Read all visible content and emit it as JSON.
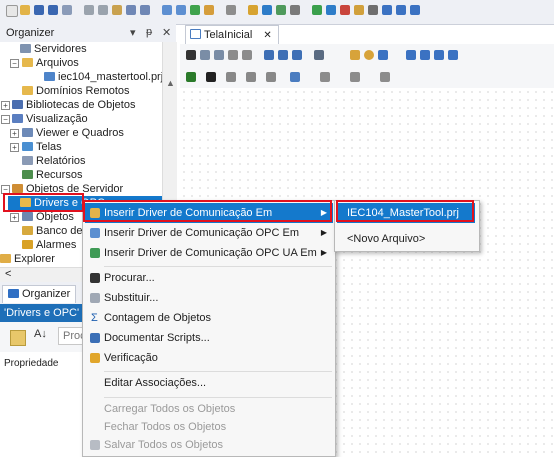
{
  "colors": {
    "accent_blue": "#1479cc",
    "highlight_red": "#e1111e",
    "panel_bg": "#eef0f5",
    "menu_bg": "#f7f7f7"
  },
  "organizer": {
    "title": "Organizer",
    "pin_glyph": "▾",
    "pin2_glyph": "ᵽ",
    "close_glyph": "✕",
    "tree": [
      {
        "label": "Servidores",
        "icon": "server-icon"
      },
      {
        "label": "Arquivos",
        "icon": "folder-icon"
      },
      {
        "label": "iec104_mastertool.prj",
        "icon": "project-file-icon"
      },
      {
        "label": "Domínios Remotos",
        "icon": "folder-icon"
      },
      {
        "label": "Bibliotecas de Objetos",
        "icon": "library-icon"
      },
      {
        "label": "Visualização",
        "icon": "display-icon"
      },
      {
        "label": "Viewer e Quadros",
        "icon": "viewer-icon"
      },
      {
        "label": "Telas",
        "icon": "screen-icon"
      },
      {
        "label": "Relatórios",
        "icon": "report-icon"
      },
      {
        "label": "Recursos",
        "icon": "resource-icon"
      },
      {
        "label": "Objetos de Servidor",
        "icon": "server-objects-icon"
      },
      {
        "label": "Drivers e OPC",
        "icon": "drivers-icon"
      },
      {
        "label": "Objetos",
        "icon": "objects-icon"
      },
      {
        "label": "Banco de",
        "icon": "database-icon"
      },
      {
        "label": "Alarmes",
        "icon": "alarm-icon"
      },
      {
        "label": "Explorer",
        "icon": "explorer-icon"
      }
    ],
    "tab_label": "Organizer",
    "scroll_left_glyph": "<"
  },
  "properties": {
    "header": "'Drivers e OPC' -",
    "search_placeholder": "Proc",
    "label": "Propriedade"
  },
  "document": {
    "tab_label": "TelaInicial",
    "tab_close": "✕"
  },
  "context_menu": {
    "items": [
      {
        "label": "Inserir Driver de Comunicação Em",
        "icon": "driver-insert-icon",
        "arrow": "▶"
      },
      {
        "label": "Inserir Driver de Comunicação OPC Em",
        "icon": "opc-insert-icon",
        "arrow": "▶"
      },
      {
        "label": "Inserir Driver de Comunicação OPC UA Em",
        "icon": "opc-ua-insert-icon",
        "arrow": "▶"
      },
      {
        "label": "Procurar...",
        "icon": "binoculars-icon"
      },
      {
        "label": "Substituir...",
        "icon": "replace-icon"
      },
      {
        "label": "Contagem de Objetos",
        "icon": "sigma-icon",
        "glyph": "Σ"
      },
      {
        "label": "Documentar Scripts...",
        "icon": "document-scripts-icon"
      },
      {
        "label": "Verificação",
        "icon": "verify-icon"
      },
      {
        "label": "Editar Associações..."
      },
      {
        "label": "Carregar Todos os Objetos"
      },
      {
        "label": "Fechar Todos os Objetos"
      },
      {
        "label": "Salvar Todos os Objetos",
        "icon": "save-all-icon"
      }
    ]
  },
  "submenu": {
    "items": [
      {
        "label": "IEC104_MasterTool.prj"
      },
      {
        "label": "<Novo Arquivo>"
      }
    ]
  }
}
